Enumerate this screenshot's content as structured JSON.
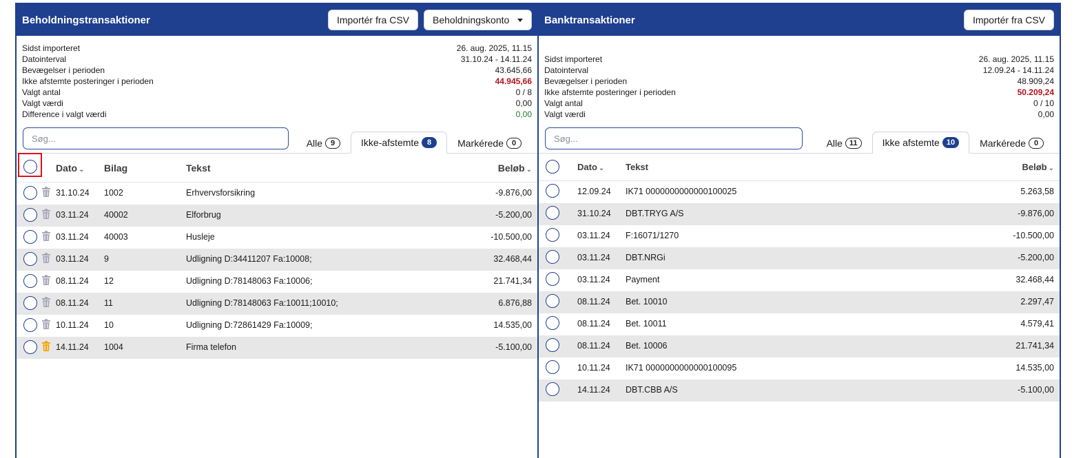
{
  "left": {
    "title": "Beholdningstransaktioner",
    "import_button": "Importér fra CSV",
    "account_dropdown": "Beholdningskonto",
    "stats": [
      {
        "label": "Sidst importeret",
        "value": "26. aug. 2025, 11.15",
        "style": ""
      },
      {
        "label": "Datointerval",
        "value": "31.10.24 - 14.11.24",
        "style": ""
      },
      {
        "label": "Bevægelser i perioden",
        "value": "43.645,66",
        "style": ""
      },
      {
        "label": "Ikke afstemte posteringer i perioden",
        "value": "44.945,66",
        "style": "red"
      },
      {
        "label": "Valgt antal",
        "value": "0 / 8",
        "style": ""
      },
      {
        "label": "Valgt værdi",
        "value": "0,00",
        "style": ""
      },
      {
        "label": "Difference i valgt værdi",
        "value": "0,00",
        "style": "green"
      }
    ],
    "search_placeholder": "Søg...",
    "tabs": [
      {
        "label": "Alle",
        "count": "9",
        "active": false
      },
      {
        "label": "Ikke-afstemte",
        "count": "8",
        "active": true
      },
      {
        "label": "Markérede",
        "count": "0",
        "active": false
      }
    ],
    "columns": {
      "date": "Dato",
      "voucher": "Bilag",
      "text": "Tekst",
      "amount": "Beløb"
    },
    "rows": [
      {
        "date": "31.10.24",
        "voucher": "1002",
        "text": "Erhvervsforsikring",
        "amount": "-9.876,00"
      },
      {
        "date": "03.11.24",
        "voucher": "40002",
        "text": "Elforbrug",
        "amount": "-5.200,00"
      },
      {
        "date": "03.11.24",
        "voucher": "40003",
        "text": "Husleje",
        "amount": "-10.500,00"
      },
      {
        "date": "03.11.24",
        "voucher": "9",
        "text": "Udligning D:34411207 Fa:10008;",
        "amount": "32.468,44"
      },
      {
        "date": "08.11.24",
        "voucher": "12",
        "text": "Udligning D:78148063 Fa:10006;",
        "amount": "21.741,34"
      },
      {
        "date": "08.11.24",
        "voucher": "11",
        "text": "Udligning D:78148063 Fa:10011;10010;",
        "amount": "6.876,88"
      },
      {
        "date": "10.11.24",
        "voucher": "10",
        "text": "Udligning D:72861429 Fa:10009;",
        "amount": "14.535,00"
      },
      {
        "date": "14.11.24",
        "voucher": "1004",
        "text": "Firma telefon",
        "amount": "-5.100,00"
      }
    ]
  },
  "right": {
    "title": "Banktransaktioner",
    "import_button": "Importér fra CSV",
    "stats": [
      {
        "label": "Sidst importeret",
        "value": "26. aug. 2025, 11.15",
        "style": ""
      },
      {
        "label": "Datointerval",
        "value": "12.09.24 - 14.11.24",
        "style": ""
      },
      {
        "label": "Bevægelser i perioden",
        "value": "48.909,24",
        "style": ""
      },
      {
        "label": "Ikke afstemte posteringer i perioden",
        "value": "50.209,24",
        "style": "red"
      },
      {
        "label": "Valgt antal",
        "value": "0 / 10",
        "style": ""
      },
      {
        "label": "Valgt værdi",
        "value": "0,00",
        "style": ""
      }
    ],
    "search_placeholder": "Søg...",
    "tabs": [
      {
        "label": "Alle",
        "count": "11",
        "active": false
      },
      {
        "label": "Ikke afstemte",
        "count": "10",
        "active": true
      },
      {
        "label": "Markérede",
        "count": "0",
        "active": false
      }
    ],
    "columns": {
      "date": "Dato",
      "text": "Tekst",
      "amount": "Beløb"
    },
    "rows": [
      {
        "date": "12.09.24",
        "text": "IK71 0000000000000100025",
        "amount": "5.263,58"
      },
      {
        "date": "31.10.24",
        "text": "DBT.TRYG A/S",
        "amount": "-9.876,00"
      },
      {
        "date": "03.11.24",
        "text": "F:16071/1270",
        "amount": "-10.500,00"
      },
      {
        "date": "03.11.24",
        "text": "DBT.NRGi",
        "amount": "-5.200,00"
      },
      {
        "date": "03.11.24",
        "text": "Payment",
        "amount": "32.468,44"
      },
      {
        "date": "08.11.24",
        "text": "Bet. 10010",
        "amount": "2.297,47"
      },
      {
        "date": "08.11.24",
        "text": "Bet. 10011",
        "amount": "4.579,41"
      },
      {
        "date": "08.11.24",
        "text": "Bet. 10006",
        "amount": "21.741,34"
      },
      {
        "date": "10.11.24",
        "text": "IK71 0000000000000100095",
        "amount": "14.535,00"
      },
      {
        "date": "14.11.24",
        "text": "DBT.CBB A/S",
        "amount": "-5.100,00"
      }
    ]
  },
  "colors": {
    "header_blue": "#1f3f8f",
    "trash_grey": "#a5a5b8",
    "trash_active": "#f5a100",
    "negative_red": "#b3121f",
    "positive_green": "#1e7d32",
    "highlight_box": "#e0101a"
  },
  "icons": {
    "trash": "trash-icon",
    "dropdown": "caret-down-icon",
    "sort": "chevron-down-icon",
    "select": "circle-checkbox"
  }
}
